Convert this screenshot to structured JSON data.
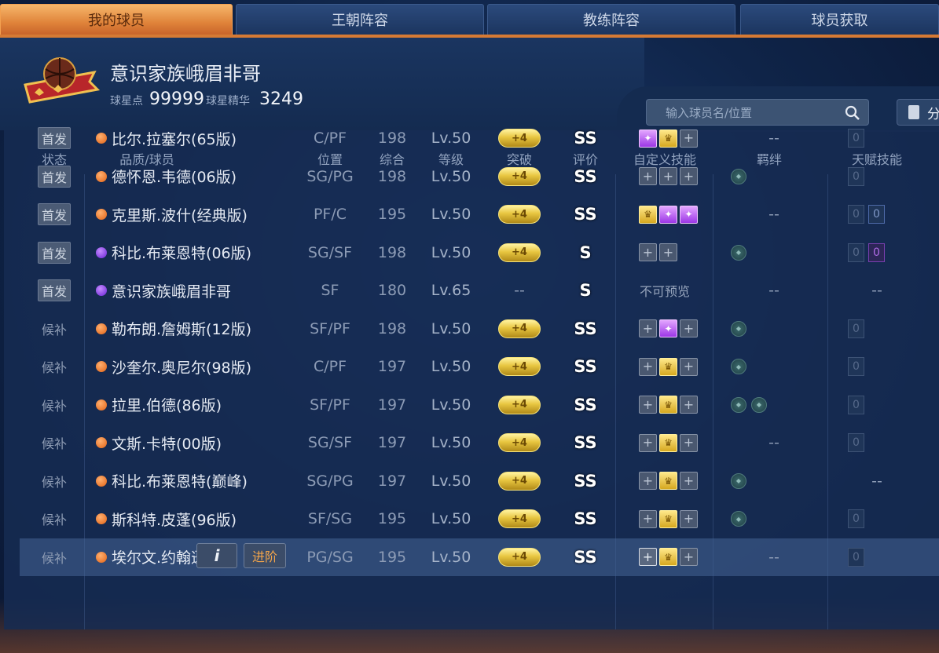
{
  "tabs": [
    {
      "label": "我的球员",
      "active": true
    },
    {
      "label": "王朝阵容",
      "active": false
    },
    {
      "label": "教练阵容",
      "active": false
    },
    {
      "label": "球员获取",
      "active": false
    }
  ],
  "profile": {
    "name": "意识家族峨眉非哥",
    "star_points_label": "球星点",
    "star_points": "99999",
    "essence_label": "球星精华",
    "essence": "3249"
  },
  "search": {
    "placeholder": "输入球员名/位置",
    "filter_label": "分"
  },
  "columns": {
    "status": "状态",
    "player": "品质/球员",
    "position": "位置",
    "overall": "综合",
    "level": "等级",
    "breakthrough": "突破",
    "rating": "评价",
    "skills": "自定义技能",
    "bonds": "羁绊",
    "talents": "天赋技能"
  },
  "rows": [
    {
      "status": "首发",
      "starter": true,
      "quality": "orange",
      "name": "比尔.拉塞尔(65版)",
      "pos": "C/PF",
      "ovr": "198",
      "lv": "Lv.50",
      "brk": "+4",
      "grade": "SS",
      "skills": [
        "purple",
        "gold",
        "plus"
      ],
      "bonds": "--",
      "bond_icons": [],
      "talents": [
        "0"
      ]
    },
    {
      "status": "首发",
      "starter": true,
      "quality": "orange",
      "name": "德怀恩.韦德(06版)",
      "pos": "SG/PG",
      "ovr": "198",
      "lv": "Lv.50",
      "brk": "+4",
      "grade": "SS",
      "skills": [
        "plus",
        "plus",
        "plus"
      ],
      "bonds": "",
      "bond_icons": [
        "bond-icon"
      ],
      "talents": [
        "0"
      ]
    },
    {
      "status": "首发",
      "starter": true,
      "quality": "orange",
      "name": "克里斯.波什(经典版)",
      "pos": "PF/C",
      "ovr": "195",
      "lv": "Lv.50",
      "brk": "+4",
      "grade": "SS",
      "skills": [
        "gold",
        "purple",
        "purple"
      ],
      "bonds": "--",
      "bond_icons": [],
      "talents": [
        "0",
        "0"
      ]
    },
    {
      "status": "首发",
      "starter": true,
      "quality": "purple",
      "name": "科比.布莱恩特(06版)",
      "pos": "SG/SF",
      "ovr": "198",
      "lv": "Lv.50",
      "brk": "+4",
      "grade": "S",
      "skills": [
        "plus",
        "plus"
      ],
      "bonds": "",
      "bond_icons": [
        "bond-icon"
      ],
      "talents": [
        "0",
        "0p"
      ]
    },
    {
      "status": "首发",
      "starter": true,
      "quality": "purple",
      "name": "意识家族峨眉非哥",
      "pos": "SF",
      "ovr": "180",
      "lv": "Lv.65",
      "brk": "--",
      "grade": "S",
      "skills_text": "不可预览",
      "skills": [],
      "bonds": "--",
      "bond_icons": [],
      "talents_text": "--",
      "talents": []
    },
    {
      "status": "候补",
      "starter": false,
      "quality": "orange",
      "name": "勒布朗.詹姆斯(12版)",
      "pos": "SF/PF",
      "ovr": "198",
      "lv": "Lv.50",
      "brk": "+4",
      "grade": "SS",
      "skills": [
        "plus",
        "purple",
        "plus"
      ],
      "bonds": "",
      "bond_icons": [
        "bond-icon"
      ],
      "talents": [
        "0"
      ]
    },
    {
      "status": "候补",
      "starter": false,
      "quality": "orange",
      "name": "沙奎尔.奥尼尔(98版)",
      "pos": "C/PF",
      "ovr": "197",
      "lv": "Lv.50",
      "brk": "+4",
      "grade": "SS",
      "skills": [
        "plus",
        "gold",
        "plus"
      ],
      "bonds": "",
      "bond_icons": [
        "bond-icon"
      ],
      "talents": [
        "0"
      ]
    },
    {
      "status": "候补",
      "starter": false,
      "quality": "orange",
      "name": "拉里.伯德(86版)",
      "pos": "SF/PF",
      "ovr": "197",
      "lv": "Lv.50",
      "brk": "+4",
      "grade": "SS",
      "skills": [
        "plus",
        "gold",
        "plus"
      ],
      "bonds": "",
      "bond_icons": [
        "bond-icon",
        "bond-icon"
      ],
      "talents": [
        "0"
      ]
    },
    {
      "status": "候补",
      "starter": false,
      "quality": "orange",
      "name": "文斯.卡特(00版)",
      "pos": "SG/SF",
      "ovr": "197",
      "lv": "Lv.50",
      "brk": "+4",
      "grade": "SS",
      "skills": [
        "plus",
        "gold",
        "plus"
      ],
      "bonds": "--",
      "bond_icons": [],
      "talents": [
        "0"
      ]
    },
    {
      "status": "候补",
      "starter": false,
      "quality": "orange",
      "name": "科比.布莱恩特(巅峰)",
      "pos": "SG/PG",
      "ovr": "197",
      "lv": "Lv.50",
      "brk": "+4",
      "grade": "SS",
      "skills": [
        "plus",
        "gold",
        "plus"
      ],
      "bonds": "",
      "bond_icons": [
        "bond-icon"
      ],
      "talents_text": "--",
      "talents": []
    },
    {
      "status": "候补",
      "starter": false,
      "quality": "orange",
      "name": "斯科特.皮蓬(96版)",
      "pos": "SF/SG",
      "ovr": "195",
      "lv": "Lv.50",
      "brk": "+4",
      "grade": "SS",
      "skills": [
        "plus",
        "gold",
        "plus"
      ],
      "bonds": "",
      "bond_icons": [
        "bond-icon"
      ],
      "talents": [
        "0"
      ]
    },
    {
      "status": "候补",
      "starter": false,
      "quality": "orange",
      "name": "埃尔文.约翰逊",
      "pos": "PG/SG",
      "ovr": "195",
      "lv": "Lv.50",
      "brk": "+4",
      "grade": "SS",
      "skills": [
        "white",
        "gold",
        "plus"
      ],
      "bonds": "--",
      "bond_icons": [],
      "talents": [
        "0"
      ],
      "selected": true
    }
  ],
  "row_actions": {
    "info": "i",
    "advance": "进阶"
  }
}
